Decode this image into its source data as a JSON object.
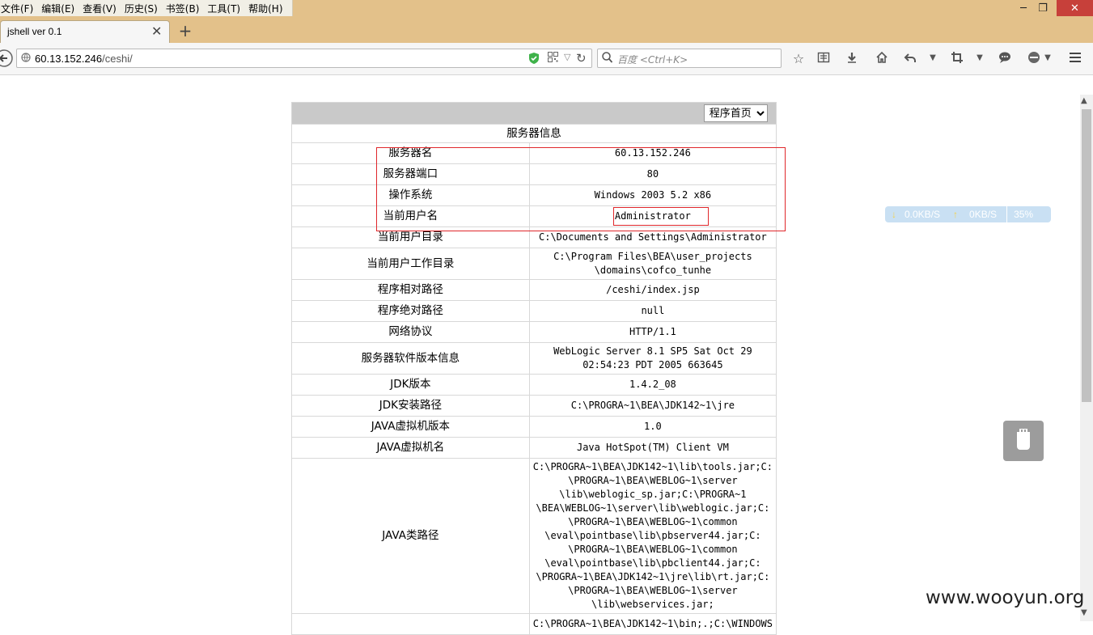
{
  "menubar": {
    "items": [
      "文件(F)",
      "编辑(E)",
      "查看(V)",
      "历史(S)",
      "书签(B)",
      "工具(T)",
      "帮助(H)"
    ]
  },
  "window_controls": {
    "minimize": "─",
    "restore": "❐",
    "close": "✕"
  },
  "tab": {
    "title": "jshell ver 0.1",
    "close_glyph": "✕",
    "new_tab_glyph": "+"
  },
  "navbar": {
    "url_host": "60.13.152.246",
    "url_path": "/ceshi/",
    "search_placeholder": "百度 <Ctrl+K>"
  },
  "page": {
    "select_value": "程序首页",
    "section_title": "服务器信息",
    "rows": [
      {
        "label": "服务器名",
        "value": "60.13.152.246"
      },
      {
        "label": "服务器端口",
        "value": "80"
      },
      {
        "label": "操作系统",
        "value": "Windows 2003 5.2 x86"
      },
      {
        "label": "当前用户名",
        "value": "Administrator"
      },
      {
        "label": "当前用户目录",
        "value": "C:\\Documents and Settings\\Administrator"
      },
      {
        "label": "当前用户工作目录",
        "value": "C:\\Program Files\\BEA\\user_projects\n\\domains\\cofco_tunhe"
      },
      {
        "label": "程序相对路径",
        "value": "/ceshi/index.jsp"
      },
      {
        "label": "程序绝对路径",
        "value": "null"
      },
      {
        "label": "网络协议",
        "value": "HTTP/1.1"
      },
      {
        "label": "服务器软件版本信息",
        "value": "WebLogic Server 8.1 SP5 Sat Oct 29\n02:54:23 PDT 2005 663645"
      },
      {
        "label": "JDK版本",
        "value": "1.4.2_08"
      },
      {
        "label": "JDK安装路径",
        "value": "C:\\PROGRA~1\\BEA\\JDK142~1\\jre"
      },
      {
        "label": "JAVA虚拟机版本",
        "value": "1.0"
      },
      {
        "label": "JAVA虚拟机名",
        "value": "Java HotSpot(TM) Client VM"
      },
      {
        "label": "JAVA类路径",
        "value": "C:\\PROGRA~1\\BEA\\JDK142~1\\lib\\tools.jar;C:\n\\PROGRA~1\\BEA\\WEBLOG~1\\server\n\\lib\\weblogic_sp.jar;C:\\PROGRA~1\n\\BEA\\WEBLOG~1\\server\\lib\\weblogic.jar;C:\n\\PROGRA~1\\BEA\\WEBLOG~1\\common\n\\eval\\pointbase\\lib\\pbserver44.jar;C:\n\\PROGRA~1\\BEA\\WEBLOG~1\\common\n\\eval\\pointbase\\lib\\pbclient44.jar;C:\n\\PROGRA~1\\BEA\\JDK142~1\\jre\\lib\\rt.jar;C:\n\\PROGRA~1\\BEA\\WEBLOG~1\\server\n\\lib\\webservices.jar;"
      },
      {
        "label": "",
        "value": "C:\\PROGRA~1\\BEA\\JDK142~1\\bin;.;C:\\WINDOWS"
      }
    ]
  },
  "speed_widget": {
    "down": "0.0KB/S",
    "up": "0KB/S",
    "percent": "35%"
  },
  "watermark": "www.wooyun.org",
  "colors": {
    "titlebar": "#e3c18a",
    "highlight_box": "#e0272b",
    "header_row": "#c9c9c9"
  }
}
